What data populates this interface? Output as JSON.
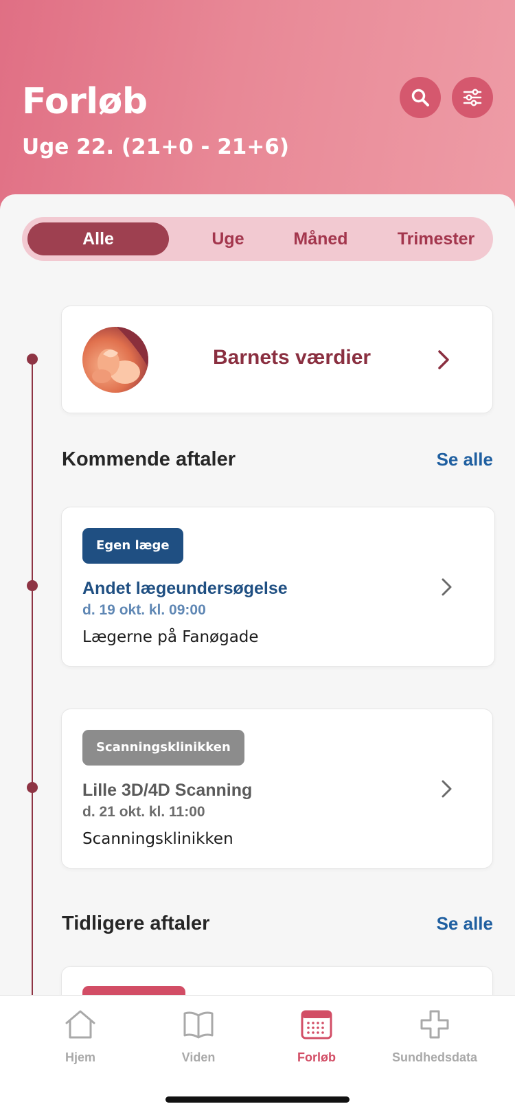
{
  "header": {
    "title": "Forløb",
    "subtitle": "Uge 22. (21+0 - 21+6)"
  },
  "filters": {
    "options": [
      "Alle",
      "Uge",
      "Måned",
      "Trimester"
    ],
    "selected": "Alle"
  },
  "baby_card": {
    "title": "Barnets værdier"
  },
  "upcoming": {
    "title": "Kommende aftaler",
    "see_all": "Se alle",
    "appointments": [
      {
        "tag": "Egen læge",
        "tag_color": "#1f4f82",
        "title": "Andet lægeundersøgelse",
        "title_color": "#1f4f82",
        "date": "d. 19 okt. kl. 09:00",
        "date_color": "#5f87b4",
        "place": "Lægerne på Fanøgade"
      },
      {
        "tag": "Scanningsklinikken",
        "tag_color": "#8c8c8c",
        "title": "Lille 3D/4D Scanning",
        "title_color": "#5a5a5a",
        "date": "d. 21 okt. kl. 11:00",
        "date_color": "#6b6b6b",
        "place": "Scanningsklinikken"
      }
    ]
  },
  "previous": {
    "title": "Tidligere aftaler",
    "see_all": "Se alle"
  },
  "tabbar": {
    "items": [
      {
        "label": "Hjem",
        "icon": "home-icon"
      },
      {
        "label": "Viden",
        "icon": "book-icon"
      },
      {
        "label": "Forløb",
        "icon": "calendar-icon",
        "active": true
      },
      {
        "label": "Sundhedsdata",
        "icon": "health-cross-icon"
      }
    ]
  },
  "colors": {
    "accent": "#d24d65",
    "timeline": "#8e3444",
    "link": "#1f5fa0"
  }
}
